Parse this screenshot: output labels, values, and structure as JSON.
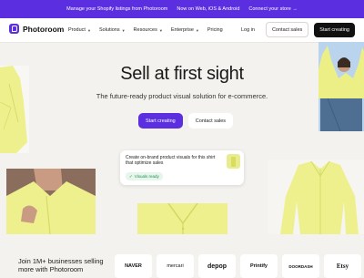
{
  "banner": {
    "text1": "Manage your Shopify listings from Photoroom",
    "text2": "Now on Web, iOS & Android",
    "text3": "Connect your store →"
  },
  "nav": {
    "brand": "Photoroom",
    "items": [
      {
        "label": "Product",
        "dropdown": true
      },
      {
        "label": "Solutions",
        "dropdown": true
      },
      {
        "label": "Resources",
        "dropdown": true
      },
      {
        "label": "Enterprise",
        "dropdown": true
      },
      {
        "label": "Pricing",
        "dropdown": false
      }
    ],
    "login": "Log in",
    "contact": "Contact sales",
    "start": "Start creating"
  },
  "hero": {
    "title": "Sell at first sight",
    "subtitle": "The future-ready product visual solution for e-commerce.",
    "cta_primary": "Start creating",
    "cta_secondary": "Contact sales"
  },
  "card": {
    "text": "Create on-brand product visuals for this shirt that optimize sales",
    "badge": "Visuals ready"
  },
  "bottom": {
    "join_text": "Join 1M+ businesses selling more with Photoroom",
    "logos": [
      "NAVER",
      "mercari",
      "depop",
      "Printify",
      "DOORDASH",
      "Etsy"
    ]
  },
  "colors": {
    "accent": "#5b2ee0",
    "background": "#f3f2ee",
    "shirt": "#eef08e",
    "badge_green": "#1f8f4e"
  }
}
